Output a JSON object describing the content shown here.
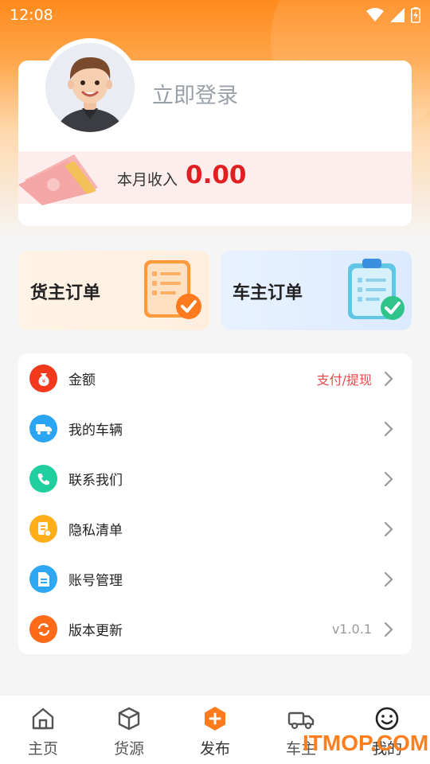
{
  "status_bar": {
    "time": "12:08"
  },
  "profile": {
    "login_text": "立即登录",
    "income_label": "本月收入",
    "income_value": "0.00"
  },
  "orders": {
    "shipper_label": "货主订单",
    "driver_label": "车主订单"
  },
  "menu": {
    "items": [
      {
        "label": "金额",
        "extra": "支付/提现",
        "icon": "money-bag-icon",
        "color": "#f2391e"
      },
      {
        "label": "我的车辆",
        "extra": "",
        "icon": "truck-icon",
        "color": "#29a5f3"
      },
      {
        "label": "联系我们",
        "extra": "",
        "icon": "phone-icon",
        "color": "#1fcf9e"
      },
      {
        "label": "隐私清单",
        "extra": "",
        "icon": "privacy-doc-icon",
        "color": "#ffae1a"
      },
      {
        "label": "账号管理",
        "extra": "",
        "icon": "document-icon",
        "color": "#2ea8f4"
      },
      {
        "label": "版本更新",
        "extra": "v1.0.1",
        "icon": "refresh-icon",
        "color": "#ff6a18"
      }
    ]
  },
  "tabs": [
    {
      "label": "主页",
      "icon": "home-icon"
    },
    {
      "label": "货源",
      "icon": "cargo-box-icon"
    },
    {
      "label": "发布",
      "icon": "publish-plus-icon"
    },
    {
      "label": "车主",
      "icon": "vehicle-icon"
    },
    {
      "label": "我的",
      "icon": "smiley-icon"
    }
  ],
  "watermark": "ITMOP.COM",
  "colors": {
    "accent": "#ff8a1c",
    "income": "#e02020",
    "extra_link": "#e84b4b",
    "version": "#999999"
  }
}
